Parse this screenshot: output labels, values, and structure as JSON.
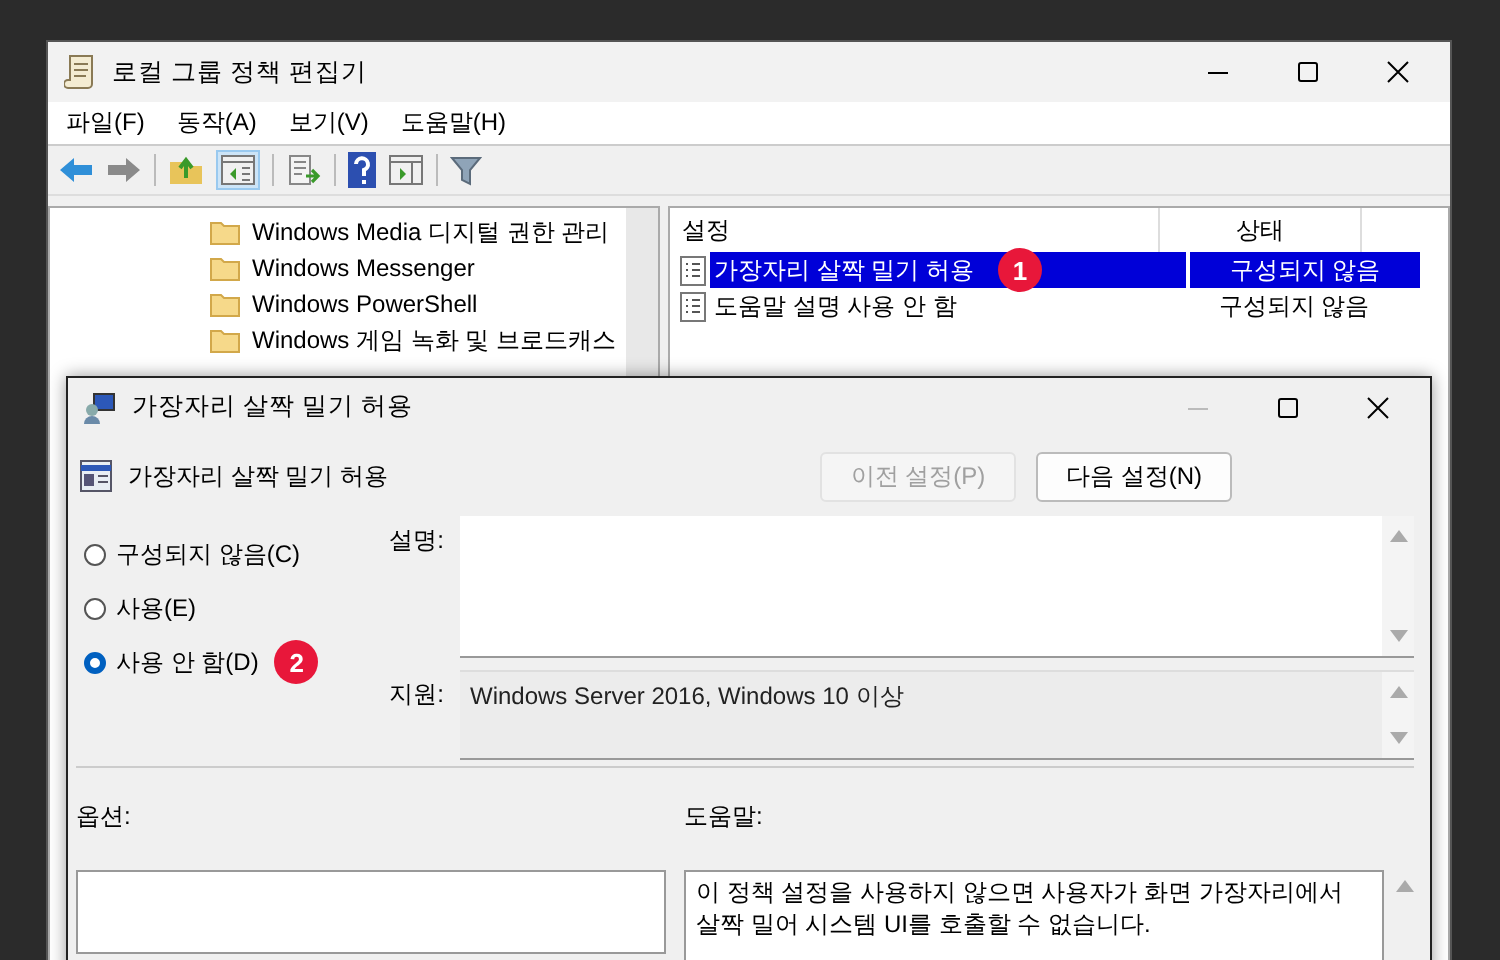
{
  "main_window": {
    "title": "로컬 그룹 정책 편집기",
    "menu": [
      "파일(F)",
      "동작(A)",
      "보기(V)",
      "도움말(H)"
    ],
    "tree": {
      "items": [
        {
          "label": "Windows Media 디지털 권한 관리"
        },
        {
          "label": "Windows Messenger"
        },
        {
          "label": "Windows PowerShell"
        },
        {
          "label": "Windows 게임 녹화 및 브로드캐스"
        }
      ]
    },
    "list": {
      "columns": [
        "설정",
        "상태"
      ],
      "rows": [
        {
          "name": "가장자리 살짝 밀기 허용",
          "state": "구성되지 않음",
          "selected": true,
          "badge": "1"
        },
        {
          "name": "도움말 설명 사용 안 함",
          "state": "구성되지 않음",
          "selected": false
        }
      ]
    }
  },
  "dialog": {
    "title": "가장자리 살짝 밀기 허용",
    "heading": "가장자리 살짝 밀기 허용",
    "buttons": [
      {
        "label": "이전 설정(P)",
        "disabled": true
      },
      {
        "label": "다음 설정(N)",
        "disabled": false
      }
    ],
    "options": [
      {
        "label": "구성되지 않음(C)",
        "selected": false
      },
      {
        "label": "사용(E)",
        "selected": false
      },
      {
        "label": "사용 안 함(D)",
        "selected": true,
        "badge": "2"
      }
    ],
    "description_label": "설명:",
    "support_label": "지원:",
    "support_text": "Windows Server 2016, Windows 10 이상",
    "options_label": "옵션:",
    "help_label": "도움말:",
    "help_text": "이 정책 설정을 사용하지 않으면 사용자가 화면 가장자리에서 살짝 밀어 시스템 UI를 호출할 수 없습니다."
  }
}
